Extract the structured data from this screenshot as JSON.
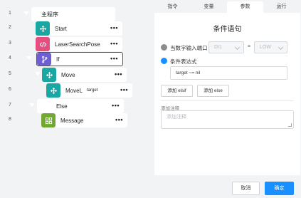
{
  "program": {
    "rows": [
      {
        "line": "1",
        "label": "主程序"
      },
      {
        "line": "2",
        "label": "Start"
      },
      {
        "line": "3",
        "label": "LaserSearchPose"
      },
      {
        "line": "4",
        "label": "If"
      },
      {
        "line": "5",
        "label": "Move"
      },
      {
        "line": "6",
        "label": "MoveL",
        "param": "target"
      },
      {
        "line": "7",
        "label": "Else"
      },
      {
        "line": "8",
        "label": "Message"
      }
    ],
    "more": "•••"
  },
  "tabs": [
    {
      "label": "指令"
    },
    {
      "label": "变量"
    },
    {
      "label": "参数"
    },
    {
      "label": "运行"
    }
  ],
  "panel": {
    "title": "条件语句",
    "option_input": {
      "label": "当数字输入端口",
      "port": "DI1",
      "operator": "=",
      "level": "LOW"
    },
    "option_expr": {
      "label": "条件表达式",
      "value": "target ~= nil"
    },
    "add_elsif": "添加 elsif",
    "add_else": "添加 else",
    "note_label": "添加注释",
    "note_placeholder": "添加注释"
  },
  "footer": {
    "cancel": "取消",
    "confirm": "确定"
  },
  "colors": {
    "accent": "#1890ff",
    "teal": "#19a7a3",
    "pink": "#e44f7f",
    "violet": "#6d5fd2",
    "green": "#72a832"
  }
}
